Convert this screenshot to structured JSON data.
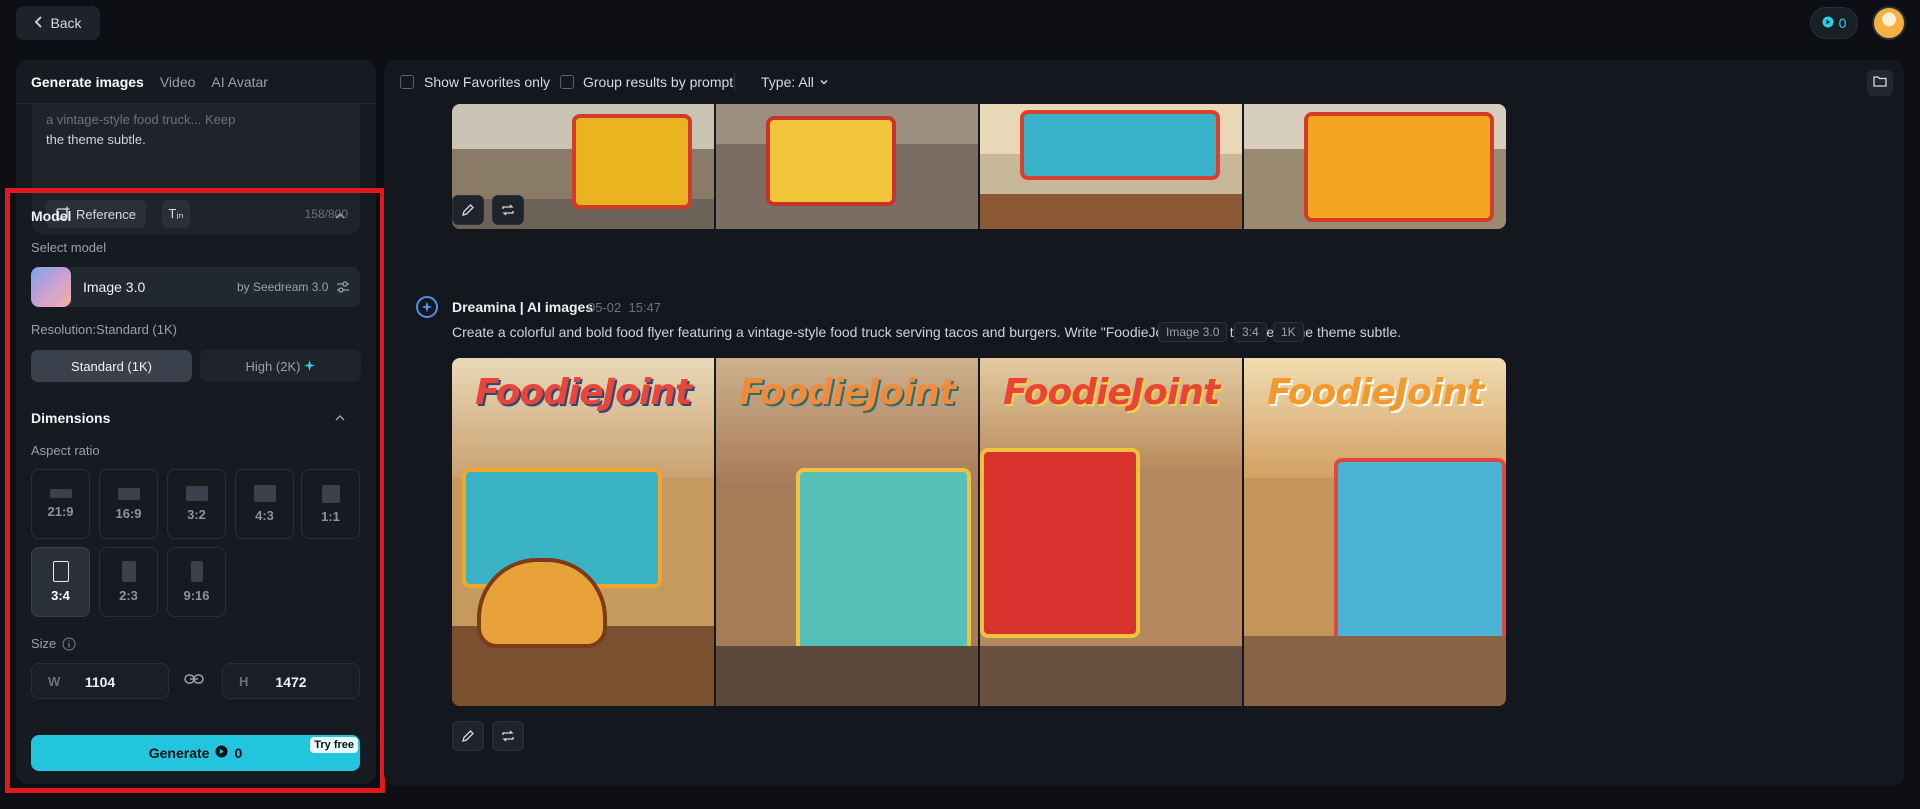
{
  "topbar": {
    "back_label": "Back",
    "credits": "0"
  },
  "left": {
    "tabs": [
      {
        "label": "Generate images"
      },
      {
        "label": "Video"
      },
      {
        "label": "AI Avatar"
      }
    ],
    "prompt": {
      "visible_text": "the theme subtle.",
      "faded_text": "a vintage-style food truck... Keep",
      "reference_label": "Reference",
      "text_icon_label": "Tᵢₙ",
      "char_count": "158/800"
    },
    "model_section": {
      "title": "Model",
      "select_label": "Select model",
      "model_name": "Image 3.0",
      "model_by": "by Seedream 3.0"
    },
    "resolution": {
      "label": "Resolution:Standard (1K)",
      "standard": "Standard (1K)",
      "high": "High (2K)"
    },
    "dimensions": {
      "title": "Dimensions",
      "aspect_label": "Aspect ratio",
      "ratios": [
        "21:9",
        "16:9",
        "3:2",
        "4:3",
        "1:1",
        "3:4",
        "2:3",
        "9:16"
      ],
      "selected": "3:4",
      "size_label": "Size",
      "width_key": "W",
      "width": "1104",
      "height_key": "H",
      "height": "1472"
    },
    "generate": {
      "label": "Generate",
      "cost": "0",
      "badge": "Try free"
    }
  },
  "main": {
    "toolbar": {
      "favorites": "Show Favorites only",
      "group": "Group results by prompt",
      "type": "Type: All"
    },
    "entry": {
      "author": "Dreamina | AI images",
      "date": "05-02",
      "time": "15:47",
      "prompt": "Create a colorful and bold food flyer featuring a vintage-style food truck serving tacos and burgers. Write \"FoodieJoint\" on the top. Keep the theme subtle.",
      "tags": [
        "Image 3.0",
        "3:4",
        "1K"
      ],
      "logo_text": "FoodieJoint"
    }
  },
  "colors": {
    "accent": "#22c5dd",
    "highlight_box": "#e1191f",
    "panel": "#161a21"
  }
}
